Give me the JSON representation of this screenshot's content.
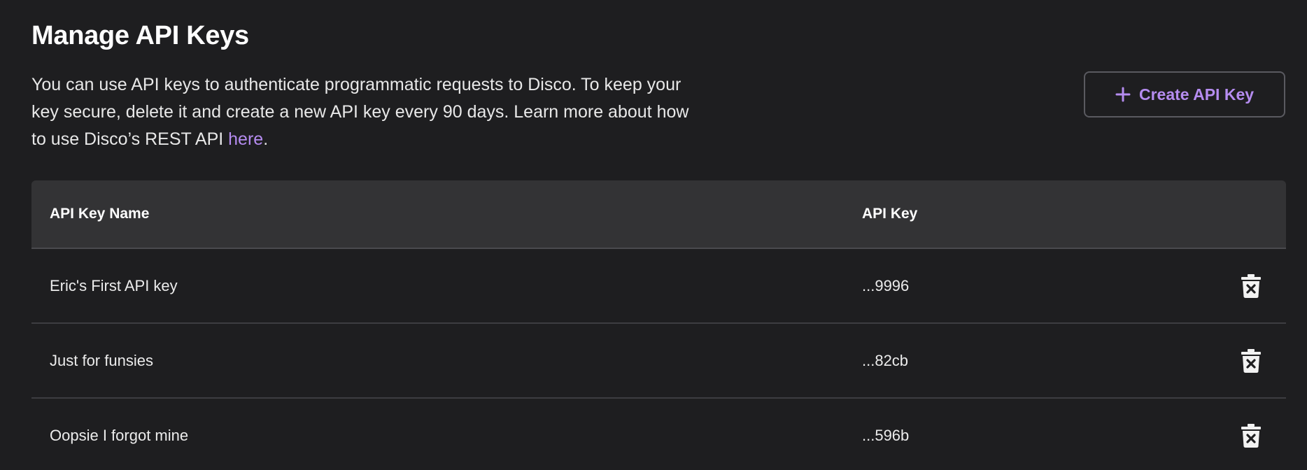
{
  "header": {
    "title": "Manage API Keys",
    "description_prefix": "You can use API keys to authenticate programmatic requests to Disco. To keep your key secure, delete it and create a new API key every 90 days. Learn more about how to use Disco’s REST API ",
    "description_link": "here",
    "description_suffix": "."
  },
  "create_button": {
    "label": "Create API Key",
    "icon": "plus-icon"
  },
  "table": {
    "columns": [
      "API Key Name",
      "API Key"
    ],
    "rows": [
      {
        "name": "Eric's First API key",
        "key": "...9996",
        "action_icon": "trash-icon"
      },
      {
        "name": "Just for funsies",
        "key": "...82cb",
        "action_icon": "trash-icon"
      },
      {
        "name": "Oopsie I forgot mine",
        "key": "...596b",
        "action_icon": "trash-icon"
      }
    ]
  },
  "colors": {
    "background": "#1e1e20",
    "accent": "#b58cf0",
    "header_bg": "#333335"
  }
}
